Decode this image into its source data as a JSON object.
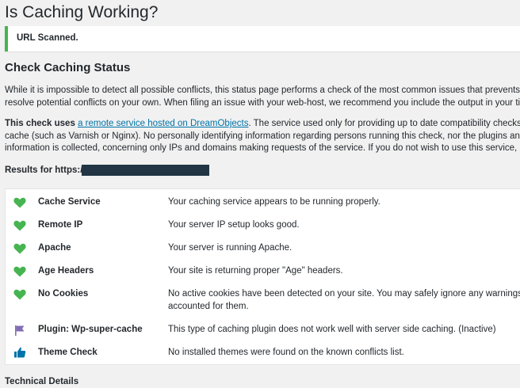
{
  "page": {
    "title": "Is Caching Working?"
  },
  "notice": {
    "text": "URL Scanned.",
    "accent_color": "#46b450"
  },
  "section": {
    "heading": "Check Caching Status",
    "para1_line1": "While it is impossible to detect all possible conflicts, this status page performs a check of the most common issues that prevents y",
    "para1_line2": "resolve potential conflicts on your own. When filing an issue with your web-host, we recommend you include the output in your tick",
    "para2_bold": "This check uses",
    "para2_link": "a remote service hosted on DreamObjects",
    "para2_line1_rest": ". The service used only for providing up to date compatibility checks o",
    "para2_line2": "cache (such as Varnish or Nginx). No personally identifying information regarding persons running this check, nor the plugins and t",
    "para2_line3": "information is collected, concerning only IPs and domains making requests of the service. If you do not wish to use this service, ple",
    "results_label": "Results for https://",
    "link_color": "#0073aa"
  },
  "status": {
    "rows": [
      {
        "icon": "heart-icon",
        "name": "Cache Service",
        "message": "Your caching service appears to be running properly.",
        "message_line2": ""
      },
      {
        "icon": "heart-icon",
        "name": "Remote IP",
        "message": "Your server IP setup looks good.",
        "message_line2": ""
      },
      {
        "icon": "heart-icon",
        "name": "Apache",
        "message": "Your server is running Apache.",
        "message_line2": ""
      },
      {
        "icon": "heart-icon",
        "name": "Age Headers",
        "message": "Your site is returning proper \"Age\" headers.",
        "message_line2": ""
      },
      {
        "icon": "heart-icon",
        "name": "No Cookies",
        "message": "No active cookies have been detected on your site. You may safely ignore any warnings ab",
        "message_line2": "accounted for them."
      },
      {
        "icon": "flag-icon",
        "name": "Plugin: Wp-super-cache",
        "message": "This type of caching plugin does not work well with server side caching. (Inactive)",
        "message_line2": ""
      },
      {
        "icon": "thumbs-up-icon",
        "name": "Theme Check",
        "message": "No installed themes were found on the known conflicts list.",
        "message_line2": ""
      }
    ],
    "colors": {
      "good": "#46b450",
      "warning": "#826eb4",
      "info": "#0073aa"
    }
  },
  "technical": {
    "heading": "Technical Details"
  }
}
